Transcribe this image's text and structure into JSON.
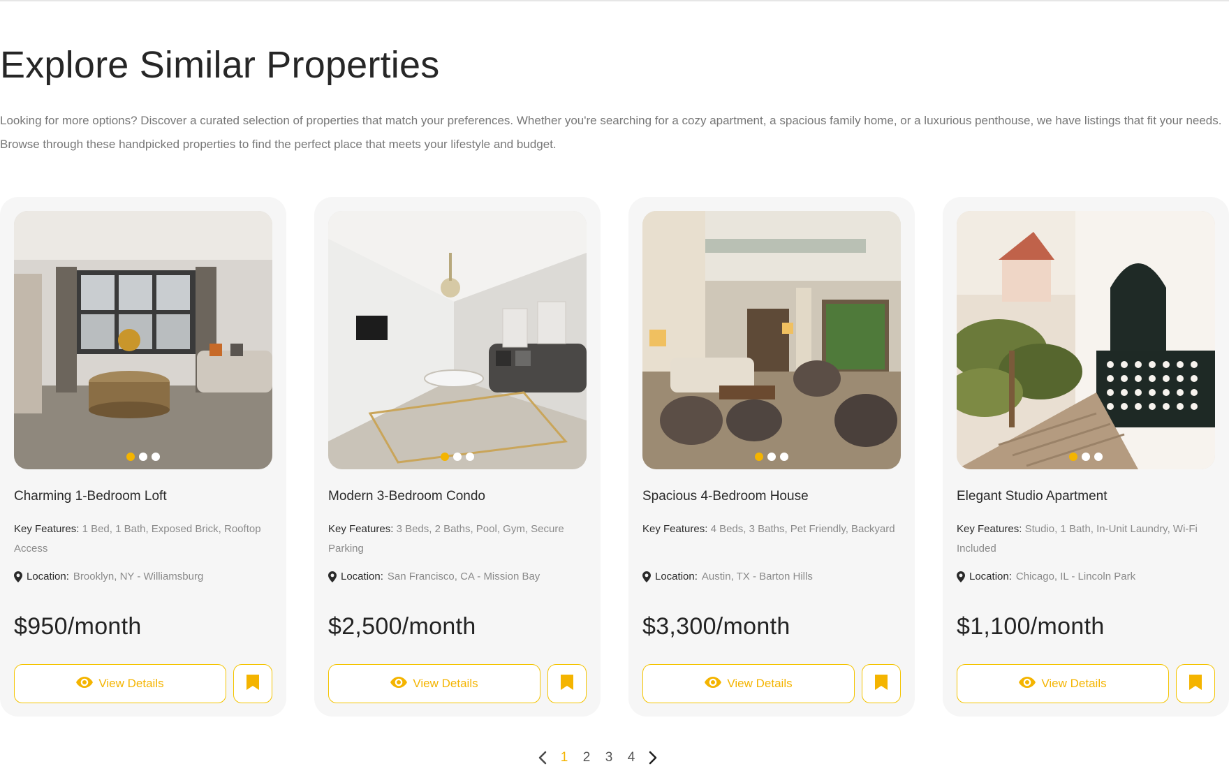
{
  "section": {
    "title": "Explore Similar Properties",
    "description": "Looking for more options? Discover a curated selection of properties that match your preferences. Whether you're searching for a cozy apartment, a spacious family home, or a luxurious penthouse, we have listings that fit your needs. Browse through these handpicked properties to find the perfect place that meets your lifestyle and budget."
  },
  "labels": {
    "key_features": "Key Features:",
    "location": "Location:",
    "view_details": "View Details"
  },
  "cards": [
    {
      "title": "Charming 1-Bedroom Loft",
      "features": "1 Bed, 1 Bath, Exposed Brick, Rooftop Access",
      "location": "Brooklyn, NY - Williamsburg",
      "price": "$950/month",
      "image_icon": "living-room-photo"
    },
    {
      "title": "Modern 3-Bedroom Condo",
      "features": "3 Beds, 2 Baths, Pool, Gym, Secure Parking",
      "location": "San Francisco, CA - Mission Bay",
      "price": "$2,500/month",
      "image_icon": "living-room-photo"
    },
    {
      "title": "Spacious 4-Bedroom House",
      "features": "4 Beds, 3 Baths, Pet Friendly, Backyard",
      "location": "Austin, TX - Barton Hills",
      "price": "$3,300/month",
      "image_icon": "living-room-photo"
    },
    {
      "title": "Elegant Studio Apartment",
      "features": "Studio, 1 Bath, In-Unit Laundry, Wi-Fi Included",
      "location": "Chicago, IL - Lincoln Park",
      "price": "$1,100/month",
      "image_icon": "exterior-photo"
    }
  ],
  "pagination": {
    "pages": [
      "1",
      "2",
      "3",
      "4"
    ],
    "active_page": "1",
    "prev_icon": "chevron-left-icon",
    "next_icon": "chevron-right-icon"
  },
  "colors": {
    "accent": "#f4b400",
    "card_bg": "#f6f6f6",
    "text": "#262626",
    "muted": "#8a8a8a"
  }
}
